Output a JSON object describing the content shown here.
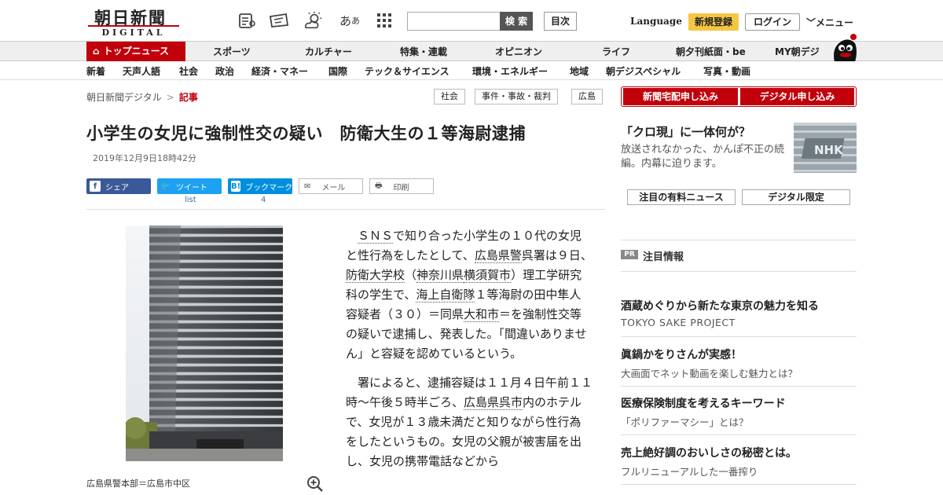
{
  "header": {
    "logo_ja": "朝日新聞",
    "logo_en": "DIGITAL",
    "search_button": "検 索",
    "search_placeholder": "",
    "toc_button": "目次",
    "language": "Language",
    "register": "新規登録",
    "login": "ログイン",
    "menu": "メニュー"
  },
  "nav_primary": [
    "トップニュース",
    "スポーツ",
    "カルチャー",
    "特集・連載",
    "オピニオン",
    "ライフ",
    "朝夕刊紙面・be",
    "MY朝デジ"
  ],
  "nav_secondary": [
    "新着",
    "天声人語",
    "社会",
    "政治",
    "経済・マネー",
    "国際",
    "テック＆サイエンス",
    "環境・エネルギー",
    "地域",
    "朝デジスペシャル",
    "写真・動画"
  ],
  "breadcrumb": {
    "home": "朝日新聞デジタル",
    "sep": ">",
    "current": "記事"
  },
  "tags": [
    "社会",
    "事件・事故・裁判",
    "広島"
  ],
  "article": {
    "title": "小学生の女児に強制性交の疑い　防衛大生の１等海尉逮捕",
    "date": "2019年12月9日18時42分",
    "share": {
      "facebook": "シェア",
      "twitter": "ツイート",
      "twitter_count": "list",
      "hatena": "ブックマーク",
      "hatena_count": "4",
      "mail": "メール",
      "print": "印刷"
    },
    "photo_caption": "広島県警本部＝広島市中区",
    "p1": [
      {
        "t": "　",
        "link": false
      },
      {
        "t": "ＳＮＳ",
        "link": true
      },
      {
        "t": "で知り合った小学生の１０代の女児と性行為をしたとして、",
        "link": false
      },
      {
        "t": "広島県警",
        "link": true
      },
      {
        "t": "呉署は９日、",
        "link": false
      },
      {
        "t": "防衛大学校",
        "link": true
      },
      {
        "t": "（",
        "link": false
      },
      {
        "t": "神奈川県",
        "link": true
      },
      {
        "t": "横須賀市",
        "link": true
      },
      {
        "t": "）理工学研究科の学生で、",
        "link": false
      },
      {
        "t": "海上自衛隊",
        "link": true
      },
      {
        "t": "１等海尉の田中隼人容疑者（３０）＝同県",
        "link": false
      },
      {
        "t": "大和市",
        "link": true
      },
      {
        "t": "＝を強制性交等の疑いで逮捕し、発表した。「間違いありません」と容疑を認めているという。",
        "link": false
      }
    ],
    "p2": [
      {
        "t": "　署によると、逮捕容疑は１１月４日午前１１時～午後５時半ごろ、",
        "link": false
      },
      {
        "t": "広島県呉市",
        "link": true
      },
      {
        "t": "内のホテルで、女児が１３歳未満だと知りながら性行為をしたというもの。女児の父親が被害届を出し、女児の携帯電話などから",
        "link": false
      }
    ]
  },
  "sidebar": {
    "apply_newspaper": "新聞宅配申し込み",
    "apply_digital": "デジタル申し込み",
    "promo_title": "「クロ現」に一体何が？",
    "promo_text": "放送されなかった、かんぽ不正の続編。内幕に迫ります。",
    "promo_logo": "NHK",
    "paid_news": "注目の有料ニュース",
    "digital_only": "デジタル限定",
    "pr_badge": "PR",
    "pr_label": "注目情報",
    "pr_items": [
      {
        "title": "酒蔵めぐりから新たな東京の魅力を知る",
        "sub": "TOKYO SAKE PROJECT"
      },
      {
        "title": "眞鍋かをりさんが実感！",
        "sub": "大画面でネット動画を楽しむ魅力とは？"
      },
      {
        "title": "医療保険制度を考えるキーワード",
        "sub": "「ポリファーマシー」とは？"
      },
      {
        "title": "売上絶好調のおいしさの秘密とは。",
        "sub": "フルリニューアルした一番搾り"
      }
    ]
  },
  "colors": {
    "brand_red": "#c1000b",
    "register_yellow": "#f6c642",
    "facebook": "#3b5998",
    "twitter": "#1da1f2",
    "hatena": "#008fde"
  }
}
